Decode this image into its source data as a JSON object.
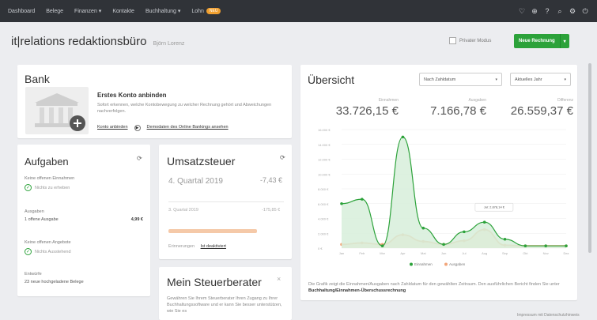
{
  "nav": {
    "items": [
      "Dashboard",
      "Belege",
      "Finanzen ▾",
      "Kontakte",
      "Buchhaltung ▾",
      "Lohn"
    ],
    "badge": "NEU",
    "icons": [
      "heart-icon",
      "plus-circle-icon",
      "help-icon",
      "search-icon",
      "settings-icon",
      "power-icon"
    ]
  },
  "header": {
    "brand": "it|relations redaktionsbüro",
    "owner": "Björn Lorenz",
    "private_mode": "Privater Modus",
    "new_invoice": "Neue Rechnung"
  },
  "bank": {
    "title": "Bank",
    "heading": "Erstes Konto anbinden",
    "text": "Sofort erkennen, welche Kontobewegung zu welcher Rechnung gehört und Abweichungen nachverfolgen.",
    "link_connect": "Konto anbinden",
    "link_demo": "Demodaten des Online Bankings ansehen"
  },
  "tasks": {
    "title": "Aufgaben",
    "groups": [
      {
        "title": "Keine offenen Einnahmen",
        "item": "Nichts zu erheben",
        "done": true
      },
      {
        "title": "Ausgaben",
        "item": "1 offene Ausgabe",
        "amount": "4,99 €",
        "done": false
      },
      {
        "title": "Keine offenen Angebote",
        "item": "Nichts Ausstehend",
        "done": true
      },
      {
        "title": "Entwürfe",
        "item": "23 neue hochgeladene Belege",
        "done": false
      }
    ]
  },
  "vat": {
    "title": "Umsatzsteuer",
    "q4_label": "4. Quartal 2019",
    "q4_value": "-7,43 €",
    "q3_label": "3. Quartal 2019",
    "q3_value": "-175,85 €",
    "reminder_label": "Erinnerungen",
    "reminder_link": "Ist deaktiviert"
  },
  "advisor": {
    "title": "Mein Steuerberater",
    "text": "Gewähren Sie Ihrem Steuerberater Ihren Zugang zu Ihrer Buchhaltungssoftware und er kann Sie besser unterstützen, wie Sie es"
  },
  "overview": {
    "title": "Übersicht",
    "select_date": "Nach Zahldatum",
    "select_period": "Aktuelles Jahr",
    "kpis": [
      {
        "label": "Einnahmen",
        "value": "33.726,15 €"
      },
      {
        "label": "Ausgaben",
        "value": "7.166,78 €"
      },
      {
        "label": "Differenz",
        "value": "26.559,37 €"
      }
    ],
    "note_prefix": "Die Grafik zeigt die Einnahmen/Ausgaben nach Zahldatum für den gewählten Zeitraum. Den ausführlichen Bericht finden Sie unter ",
    "note_link": "Buchhaltung/Einnahmen-Überschussrechnung"
  },
  "footer_note": "Impressum mit Datenschutzhinweis",
  "chart_data": {
    "type": "area",
    "categories": [
      "Jan",
      "Feb",
      "Mrz",
      "Apr",
      "Mai",
      "Jun",
      "Jul",
      "Aug",
      "Sep",
      "Okt",
      "Nov",
      "Dez"
    ],
    "y_ticks": [
      "16.000 €",
      "14.000 €",
      "12.000 €",
      "10.000 €",
      "8.000 €",
      "6.000 €",
      "4.000 €",
      "2.000 €",
      "0 €"
    ],
    "ylim": [
      0,
      16000
    ],
    "series": [
      {
        "name": "Einnahmen",
        "color": "#2ca23a",
        "fill": "#d7efdb",
        "values": [
          6000,
          6600,
          300,
          15000,
          2700,
          500,
          2200,
          3500,
          1200,
          300,
          300,
          300
        ]
      },
      {
        "name": "Ausgaben",
        "color": "#f2a67a",
        "fill": "#fbdcc8",
        "values": [
          500,
          700,
          500,
          1800,
          900,
          500,
          1000,
          2500,
          400,
          300,
          300,
          300
        ]
      }
    ],
    "tooltip": "Jul: 2.878,14 €",
    "legend_position": "bottom"
  }
}
